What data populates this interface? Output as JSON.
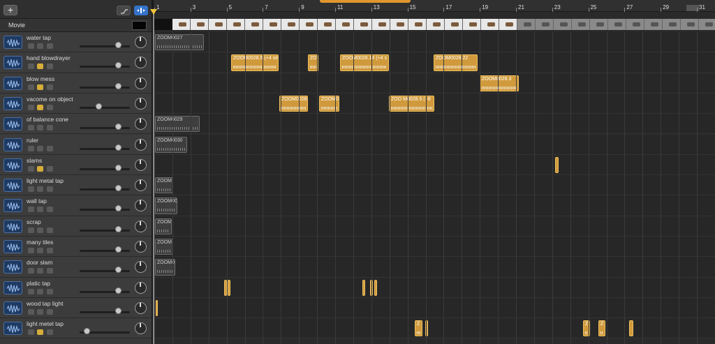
{
  "header": {
    "add_label": "+"
  },
  "movie": {
    "label": "Movie"
  },
  "ruler": {
    "ticks": [
      "1",
      "3",
      "5",
      "7",
      "9",
      "11",
      "13",
      "15",
      "17",
      "19",
      "21",
      "23",
      "25",
      "27",
      "29",
      "31"
    ]
  },
  "tracks": [
    {
      "name": "water tap"
    },
    {
      "name": "hand blowdrayer"
    },
    {
      "name": "blow mess"
    },
    {
      "name": "vacome on object"
    },
    {
      "name": "of balance cone"
    },
    {
      "name": "ruler"
    },
    {
      "name": "slams"
    },
    {
      "name": "light metal tap"
    },
    {
      "name": "wall tap"
    },
    {
      "name": "scrap"
    },
    {
      "name": "many tiles"
    },
    {
      "name": "door slam"
    },
    {
      "name": "platic tap"
    },
    {
      "name": "wood tap light"
    },
    {
      "name": "light metel tap"
    }
  ],
  "regions": [
    {
      "label": "ZOOM0027"
    },
    {
      "label": "ZOOM0028.5 (+4 se"
    },
    {
      "label": "ZO"
    },
    {
      "label": "ZOOM0028.14 (+4 s"
    },
    {
      "label": "ZOOM0028.22"
    },
    {
      "label": "ZOOM0028.3"
    },
    {
      "label": "ZOOM0028"
    },
    {
      "label": "ZOOM0"
    },
    {
      "label": "ZOO M0028.5 (+8"
    },
    {
      "label": "ZOOM0029"
    },
    {
      "label": "ZOOM0030"
    },
    {
      "label": "ZOOM"
    },
    {
      "label": "ZOOM00"
    },
    {
      "label": "ZOOM"
    },
    {
      "label": "ZOOM"
    },
    {
      "label": "ZOOM0"
    },
    {
      "label": "Z"
    },
    {
      "label": "Z"
    },
    {
      "label": "Z"
    }
  ]
}
